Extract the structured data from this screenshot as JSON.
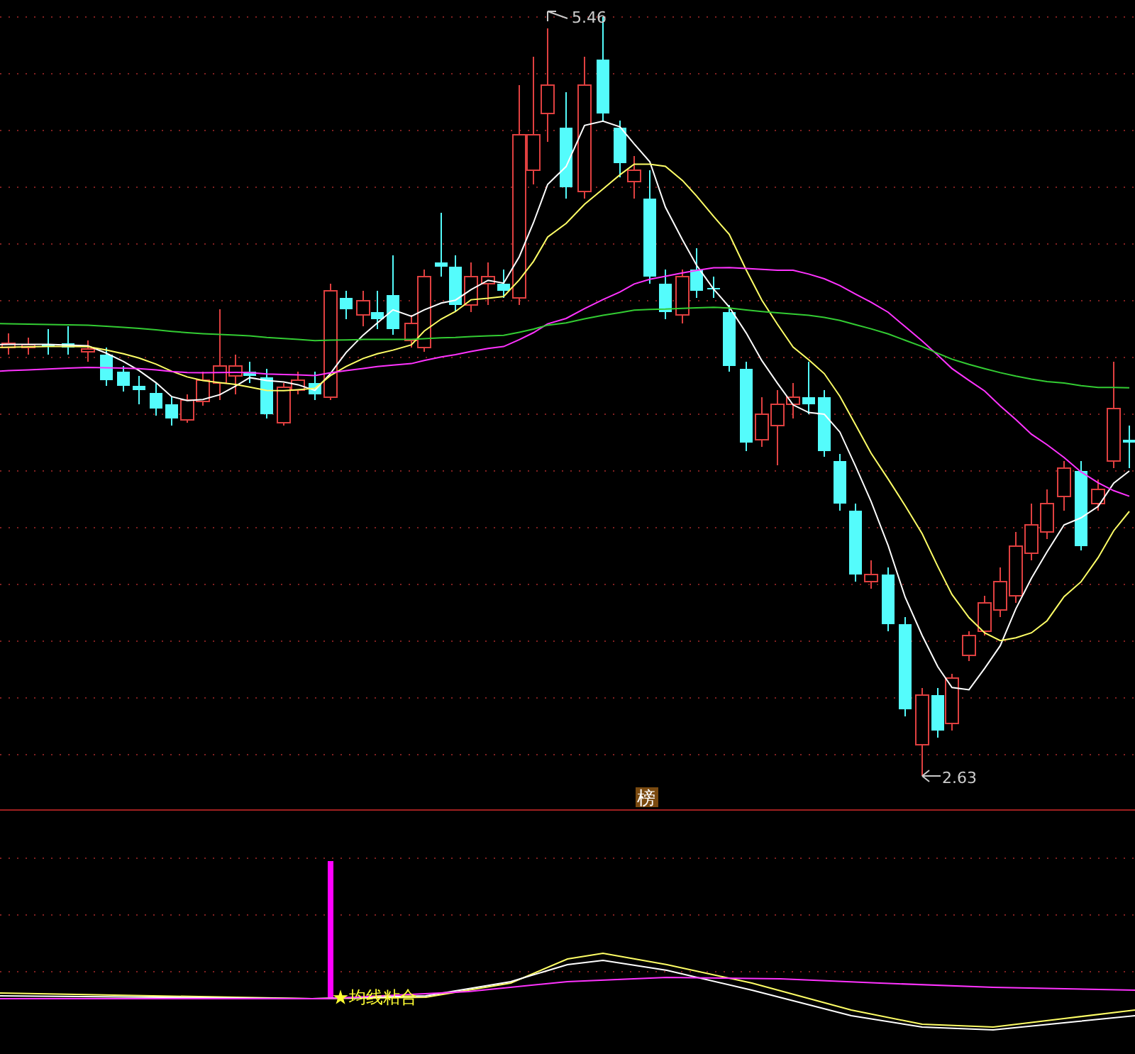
{
  "price_chart": {
    "high_label": "5.46",
    "low_label": "2.63"
  },
  "divider_tag": "榜",
  "indicator": {
    "signal_label": "★均线粘合"
  }
}
